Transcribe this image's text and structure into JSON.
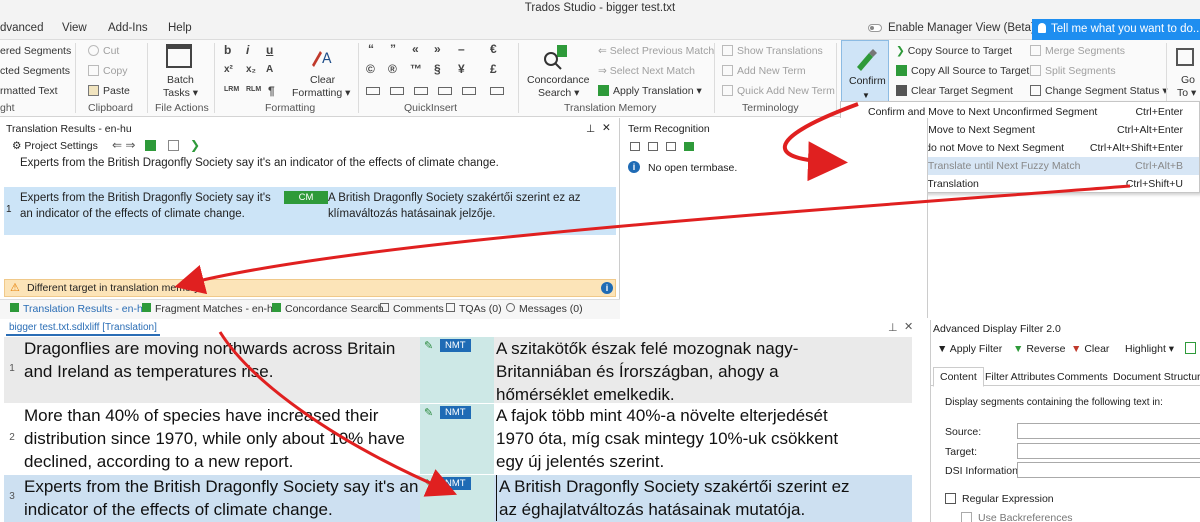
{
  "window": {
    "title": "Trados Studio - bigger test.txt"
  },
  "menubar": {
    "items": [
      "dvanced",
      "View",
      "Add-Ins",
      "Help"
    ],
    "manager_view": "Enable Manager View (Beta)",
    "tell_me": "Tell me what you want to do..."
  },
  "ribbon": {
    "left_items": [
      "ered Segments",
      "cted Segments",
      "rmatted Text"
    ],
    "left_group": "ght",
    "clipboard": {
      "cut": "Cut",
      "copy": "Copy",
      "paste": "Paste",
      "group": "Clipboard"
    },
    "file_actions": {
      "batch": "Batch",
      "tasks": "Tasks ▾",
      "group": "File Actions"
    },
    "formatting": {
      "clear": "Clear",
      "formatting": "Formatting ▾",
      "group": "Formatting"
    },
    "quickinsert": {
      "group": "QuickInsert",
      "symbols_top": [
        "“",
        "”",
        "«",
        "»",
        "–",
        "€"
      ],
      "symbols_mid": [
        "©",
        "®",
        "™",
        "§",
        "¥",
        "£"
      ]
    },
    "tm": {
      "concordance": "Concordance",
      "search": "Search ▾",
      "prev_match": "Select Previous Match",
      "next_match": "Select Next Match",
      "apply": "Apply Translation ▾",
      "group": "Translation Memory"
    },
    "terminology": {
      "show": "Show Translations",
      "add": "Add New Term",
      "quick": "Quick Add New Term",
      "group": "Terminology"
    },
    "confirm": "Confirm",
    "copy_source": "Copy Source to Target",
    "copy_all": "Copy All Source to Target",
    "clear_target": "Clear Target Segment",
    "merge": "Merge Segments",
    "split": "Split Segments",
    "change_status": "Change Segment Status ▾",
    "go": "Go",
    "to": "To ▾"
  },
  "confirm_menu": [
    {
      "label": "Confirm and Move to Next Unconfirmed Segment",
      "shortcut": "Ctrl+Enter"
    },
    {
      "label": "Confirm and Move to Next Segment",
      "shortcut": "Ctrl+Alt+Enter"
    },
    {
      "label": "Confirm but do not Move to Next Segment",
      "shortcut": "Ctrl+Alt+Shift+Enter"
    },
    {
      "label": "Confirm and Translate until Next Fuzzy Match",
      "shortcut": "Ctrl+Alt+B"
    },
    {
      "label": "Add as New Translation",
      "shortcut": "Ctrl+Shift+U"
    }
  ],
  "translation_results": {
    "title": "Translation Results - en-hu",
    "project_settings": "Project Settings",
    "source_line": "Experts from the British Dragonfly Society say it's an indicator of the effects of climate change.",
    "result_num": "1",
    "result_src": "Experts from the British Dragonfly Society say it's an indicator of the effects of climate change.",
    "result_badge": "CM",
    "result_tgt": "A British Dragonfly Society szakértői szerint ez az klímaváltozás hatásainak jelzője.",
    "warning": "Different target in translation memory."
  },
  "tabs": [
    "Translation Results - en-hu",
    "Fragment Matches - en-hu",
    "Concordance Search",
    "Comments",
    "TQAs (0)",
    "Messages (0)"
  ],
  "term_recognition": {
    "title": "Term Recognition",
    "message": "No open termbase."
  },
  "editor": {
    "doc_tab": "bigger test.txt.sdlxliff [Translation]",
    "segments": [
      {
        "num": "1",
        "status": "NMT",
        "source": "Dragonflies are moving northwards across Britain and Ireland as temperatures rise.",
        "target": "A szitakötők észak felé mozognak nagy-Britanniában és Írországban, ahogy a hőmérséklet emelkedik."
      },
      {
        "num": "2",
        "status": "NMT",
        "source": "More than 40% of species have increased their distribution since 1970, while only about 10% have declined, according to a new report.",
        "target": "A fajok több mint 40%-a növelte elterjedését 1970 óta, míg csak mintegy 10%-uk csökkent egy új jelentés szerint."
      },
      {
        "num": "3",
        "status": "NMT",
        "source": "Experts from the British Dragonfly Society say it's an indicator of the effects of climate change.",
        "target": "A British Dragonfly Society szakértői szerint ez az éghajlatváltozás hatásainak mutatója."
      }
    ]
  },
  "filter": {
    "title": "Advanced Display Filter 2.0",
    "apply": "Apply Filter",
    "reverse": "Reverse",
    "clear": "Clear",
    "highlight": "Highlight ▾",
    "tabs": [
      "Content",
      "Filter Attributes",
      "Comments",
      "Document Structure"
    ],
    "description": "Display segments containing the following text in:",
    "source_label": "Source:",
    "target_label": "Target:",
    "dsi_label": "DSI Information:",
    "regex": "Regular Expression",
    "backrefs": "Use Backreferences"
  },
  "colors": {
    "accent": "#1e8ef0",
    "nmt_badge": "#1f6bb5",
    "cm_badge": "#2e9a3a",
    "arrow": "#e02020"
  }
}
